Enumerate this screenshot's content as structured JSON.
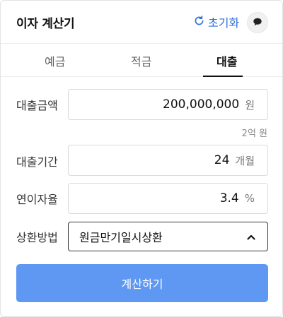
{
  "header": {
    "title": "이자 계산기",
    "reset_label": "초기화",
    "reset_icon": "refresh-icon",
    "chat_icon": "chat-bubble-icon",
    "accent_color": "#2e6fd8"
  },
  "tabs": [
    {
      "label": "예금",
      "active": false
    },
    {
      "label": "적금",
      "active": false
    },
    {
      "label": "대출",
      "active": true
    }
  ],
  "form": {
    "amount": {
      "label": "대출금액",
      "value": "200,000,000",
      "unit": "원",
      "hint": "2억 원"
    },
    "term": {
      "label": "대출기간",
      "value": "24",
      "unit": "개월"
    },
    "rate": {
      "label": "연이자율",
      "value": "3.4",
      "unit": "%"
    },
    "method": {
      "label": "상환방법",
      "value": "원금만기일시상환",
      "icon": "chevron-up-icon"
    }
  },
  "calculate_button": {
    "label": "계산하기",
    "color": "#5f98f3"
  }
}
